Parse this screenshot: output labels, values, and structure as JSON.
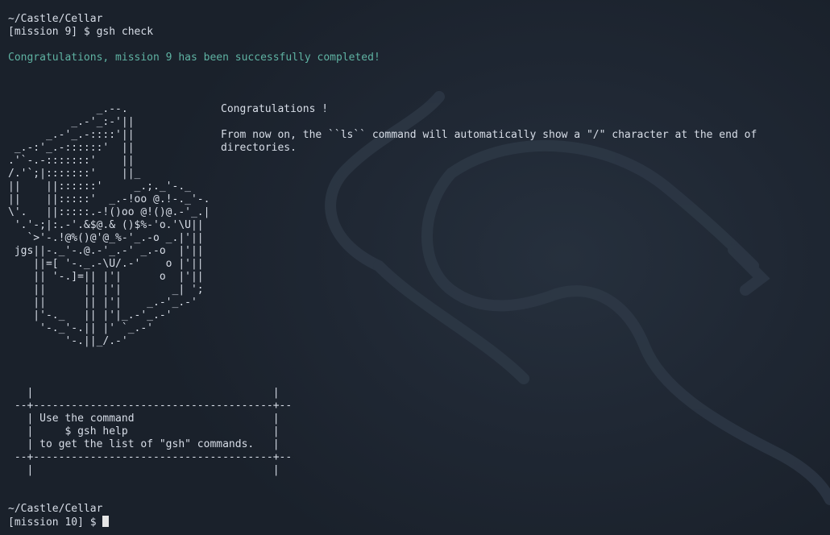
{
  "terminal": {
    "prompt1": {
      "path": "~/Castle/Cellar",
      "prompt": "[mission 9] $ ",
      "command": "gsh check"
    },
    "success_message": "Congratulations, mission 9 has been successfully completed!",
    "ascii_art": "              _.--.\n          _.-'_:-'||\n      _.-'_.-::::'||\n _.-:'_.-::::::'  ||\n.'`-.-:::::::'    ||\n/.'`;|:::::::'    ||_\n||    ||::::::'     _.;._'-._\n||    ||:::::'  _.-!oo @.!-._'-.\n\\'.   ||:::::.-!()oo @!()@.-'_.|\n '.'-;|:.-'.&$@.& ()$%-'o.'\\U||\n   `>'-.!@%()@'@_%-'_.-o _.|'||\n jgs||-._'-.@.-'_.-' _.-o  |'||\n    ||=[ '-._.-\\U/.-'    o |'||\n    || '-.]=|| |'|      o  |'||\n    ||      || |'|        _| ';\n    ||      || |'|    _.-'_.-'\n    |'-._   || |'|_.-'_.-'\n     '-._'-.|| |' `_.-'\n         '-.||_/.-'",
    "congrats_title": "Congratulations !",
    "congrats_body": "From now on, the ``ls`` command will automatically show a \"/\" character at the end of directories.",
    "help_box": "   |                                      |\n --+--------------------------------------+--\n   | Use the command                      |\n   |     $ gsh help                       |\n   | to get the list of \"gsh\" commands.   |\n --+--------------------------------------+--\n   |                                      |",
    "prompt2": {
      "path": "~/Castle/Cellar",
      "prompt": "[mission 10] $ "
    }
  },
  "colors": {
    "background": "#1c2430",
    "text": "#d8dee8",
    "success": "#5fb3a3"
  }
}
